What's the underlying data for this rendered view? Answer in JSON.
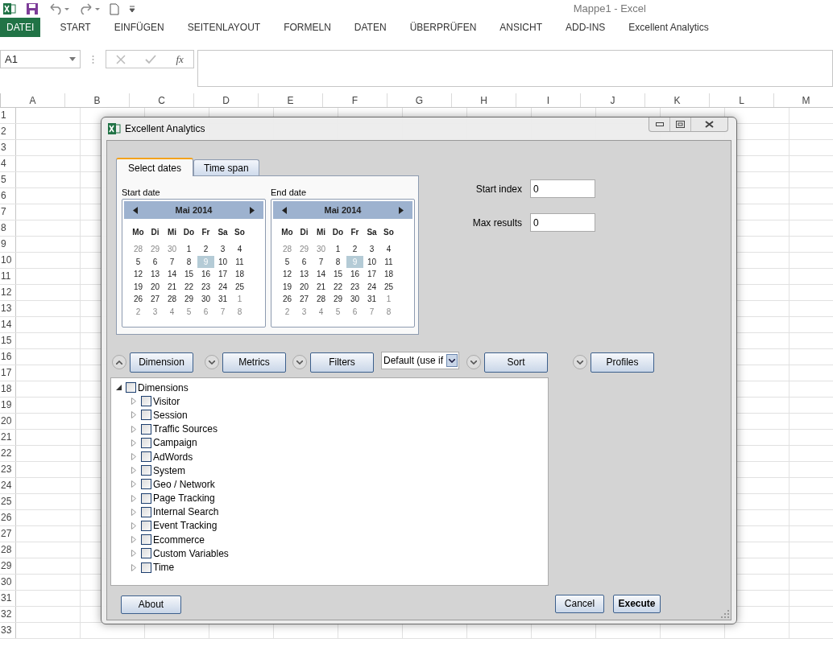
{
  "app": {
    "title": "Mappe1 - Excel"
  },
  "ribbon_tabs": [
    {
      "label": "DATEI",
      "selected": true
    },
    {
      "label": "START",
      "selected": false
    },
    {
      "label": "EINFÜGEN",
      "selected": false
    },
    {
      "label": "SEITENLAYOUT",
      "selected": false
    },
    {
      "label": "FORMELN",
      "selected": false
    },
    {
      "label": "DATEN",
      "selected": false
    },
    {
      "label": "ÜBERPRÜFEN",
      "selected": false
    },
    {
      "label": "ANSICHT",
      "selected": false
    },
    {
      "label": "ADD-INS",
      "selected": false
    },
    {
      "label": "Excellent Analytics",
      "selected": false
    }
  ],
  "name_box": {
    "value": "A1"
  },
  "formula_bar": {
    "fx": "fx"
  },
  "sheet": {
    "columns": [
      "A",
      "B",
      "C",
      "D",
      "E",
      "F",
      "G",
      "H",
      "I",
      "J",
      "K",
      "L",
      "M"
    ],
    "rows": [
      "1",
      "2",
      "3",
      "4",
      "5",
      "6",
      "7",
      "8",
      "9",
      "10",
      "11",
      "12",
      "13",
      "14",
      "15",
      "16",
      "17",
      "18",
      "19",
      "20",
      "21",
      "22",
      "23",
      "24",
      "25",
      "26",
      "27",
      "28",
      "29",
      "30",
      "31",
      "32",
      "33"
    ]
  },
  "dialog": {
    "title": "Excellent Analytics",
    "tabs": [
      {
        "label": "Select dates",
        "selected": true
      },
      {
        "label": "Time span",
        "selected": false
      }
    ],
    "calendars": [
      {
        "label": "Start date",
        "month": "Mai 2014",
        "weekdays": [
          "Mo",
          "Di",
          "Mi",
          "Do",
          "Fr",
          "Sa",
          "So"
        ],
        "weeks": [
          [
            {
              "day": "28",
              "muted": true,
              "selected": false
            },
            {
              "day": "29",
              "muted": true,
              "selected": false
            },
            {
              "day": "30",
              "muted": true,
              "selected": false
            },
            {
              "day": "1",
              "muted": false,
              "selected": false
            },
            {
              "day": "2",
              "muted": false,
              "selected": false
            },
            {
              "day": "3",
              "muted": false,
              "selected": false
            },
            {
              "day": "4",
              "muted": false,
              "selected": false
            }
          ],
          [
            {
              "day": "5",
              "muted": false,
              "selected": false
            },
            {
              "day": "6",
              "muted": false,
              "selected": false
            },
            {
              "day": "7",
              "muted": false,
              "selected": false
            },
            {
              "day": "8",
              "muted": false,
              "selected": false
            },
            {
              "day": "9",
              "muted": false,
              "selected": true
            },
            {
              "day": "10",
              "muted": false,
              "selected": false
            },
            {
              "day": "11",
              "muted": false,
              "selected": false
            }
          ],
          [
            {
              "day": "12",
              "muted": false,
              "selected": false
            },
            {
              "day": "13",
              "muted": false,
              "selected": false
            },
            {
              "day": "14",
              "muted": false,
              "selected": false
            },
            {
              "day": "15",
              "muted": false,
              "selected": false
            },
            {
              "day": "16",
              "muted": false,
              "selected": false
            },
            {
              "day": "17",
              "muted": false,
              "selected": false
            },
            {
              "day": "18",
              "muted": false,
              "selected": false
            }
          ],
          [
            {
              "day": "19",
              "muted": false,
              "selected": false
            },
            {
              "day": "20",
              "muted": false,
              "selected": false
            },
            {
              "day": "21",
              "muted": false,
              "selected": false
            },
            {
              "day": "22",
              "muted": false,
              "selected": false
            },
            {
              "day": "23",
              "muted": false,
              "selected": false
            },
            {
              "day": "24",
              "muted": false,
              "selected": false
            },
            {
              "day": "25",
              "muted": false,
              "selected": false
            }
          ],
          [
            {
              "day": "26",
              "muted": false,
              "selected": false
            },
            {
              "day": "27",
              "muted": false,
              "selected": false
            },
            {
              "day": "28",
              "muted": false,
              "selected": false
            },
            {
              "day": "29",
              "muted": false,
              "selected": false
            },
            {
              "day": "30",
              "muted": false,
              "selected": false
            },
            {
              "day": "31",
              "muted": false,
              "selected": false
            },
            {
              "day": "1",
              "muted": true,
              "selected": false
            }
          ],
          [
            {
              "day": "2",
              "muted": true,
              "selected": false
            },
            {
              "day": "3",
              "muted": true,
              "selected": false
            },
            {
              "day": "4",
              "muted": true,
              "selected": false
            },
            {
              "day": "5",
              "muted": true,
              "selected": false
            },
            {
              "day": "6",
              "muted": true,
              "selected": false
            },
            {
              "day": "7",
              "muted": true,
              "selected": false
            },
            {
              "day": "8",
              "muted": true,
              "selected": false
            }
          ]
        ]
      },
      {
        "label": "End date",
        "month": "Mai 2014",
        "weekdays": [
          "Mo",
          "Di",
          "Mi",
          "Do",
          "Fr",
          "Sa",
          "So"
        ],
        "weeks": [
          [
            {
              "day": "28",
              "muted": true,
              "selected": false
            },
            {
              "day": "29",
              "muted": true,
              "selected": false
            },
            {
              "day": "30",
              "muted": true,
              "selected": false
            },
            {
              "day": "1",
              "muted": false,
              "selected": false
            },
            {
              "day": "2",
              "muted": false,
              "selected": false
            },
            {
              "day": "3",
              "muted": false,
              "selected": false
            },
            {
              "day": "4",
              "muted": false,
              "selected": false
            }
          ],
          [
            {
              "day": "5",
              "muted": false,
              "selected": false
            },
            {
              "day": "6",
              "muted": false,
              "selected": false
            },
            {
              "day": "7",
              "muted": false,
              "selected": false
            },
            {
              "day": "8",
              "muted": false,
              "selected": false
            },
            {
              "day": "9",
              "muted": false,
              "selected": true
            },
            {
              "day": "10",
              "muted": false,
              "selected": false
            },
            {
              "day": "11",
              "muted": false,
              "selected": false
            }
          ],
          [
            {
              "day": "12",
              "muted": false,
              "selected": false
            },
            {
              "day": "13",
              "muted": false,
              "selected": false
            },
            {
              "day": "14",
              "muted": false,
              "selected": false
            },
            {
              "day": "15",
              "muted": false,
              "selected": false
            },
            {
              "day": "16",
              "muted": false,
              "selected": false
            },
            {
              "day": "17",
              "muted": false,
              "selected": false
            },
            {
              "day": "18",
              "muted": false,
              "selected": false
            }
          ],
          [
            {
              "day": "19",
              "muted": false,
              "selected": false
            },
            {
              "day": "20",
              "muted": false,
              "selected": false
            },
            {
              "day": "21",
              "muted": false,
              "selected": false
            },
            {
              "day": "22",
              "muted": false,
              "selected": false
            },
            {
              "day": "23",
              "muted": false,
              "selected": false
            },
            {
              "day": "24",
              "muted": false,
              "selected": false
            },
            {
              "day": "25",
              "muted": false,
              "selected": false
            }
          ],
          [
            {
              "day": "26",
              "muted": false,
              "selected": false
            },
            {
              "day": "27",
              "muted": false,
              "selected": false
            },
            {
              "day": "28",
              "muted": false,
              "selected": false
            },
            {
              "day": "29",
              "muted": false,
              "selected": false
            },
            {
              "day": "30",
              "muted": false,
              "selected": false
            },
            {
              "day": "31",
              "muted": false,
              "selected": false
            },
            {
              "day": "1",
              "muted": true,
              "selected": false
            }
          ],
          [
            {
              "day": "2",
              "muted": true,
              "selected": false
            },
            {
              "day": "3",
              "muted": true,
              "selected": false
            },
            {
              "day": "4",
              "muted": true,
              "selected": false
            },
            {
              "day": "5",
              "muted": true,
              "selected": false
            },
            {
              "day": "6",
              "muted": true,
              "selected": false
            },
            {
              "day": "7",
              "muted": true,
              "selected": false
            },
            {
              "day": "8",
              "muted": true,
              "selected": false
            }
          ]
        ]
      }
    ],
    "fields": [
      {
        "label": "Start index",
        "value": "0"
      },
      {
        "label": "Max results",
        "value": "0"
      }
    ],
    "toolbar": [
      {
        "kind": "section",
        "label": "Dimension",
        "expanded": true
      },
      {
        "kind": "section",
        "label": "Metrics",
        "expanded": false
      },
      {
        "kind": "section",
        "label": "Filters",
        "expanded": false
      },
      {
        "kind": "select",
        "value": "Default (use if"
      },
      {
        "kind": "section",
        "label": "Sort",
        "expanded": false
      },
      {
        "kind": "section",
        "label": "Profiles",
        "expanded": false
      }
    ],
    "tree": [
      {
        "label": "Dimensions",
        "checked": false,
        "expanded": true,
        "children": [
          {
            "label": "Visitor",
            "checked": false,
            "expanded": false
          },
          {
            "label": "Session",
            "checked": false,
            "expanded": false
          },
          {
            "label": "Traffic Sources",
            "checked": false,
            "expanded": false
          },
          {
            "label": "Campaign",
            "checked": false,
            "expanded": false
          },
          {
            "label": "AdWords",
            "checked": false,
            "expanded": false
          },
          {
            "label": "System",
            "checked": false,
            "expanded": false
          },
          {
            "label": "Geo / Network",
            "checked": false,
            "expanded": false
          },
          {
            "label": "Page Tracking",
            "checked": false,
            "expanded": false
          },
          {
            "label": "Internal Search",
            "checked": false,
            "expanded": false
          },
          {
            "label": "Event Tracking",
            "checked": false,
            "expanded": false
          },
          {
            "label": "Ecommerce",
            "checked": false,
            "expanded": false
          },
          {
            "label": "Custom Variables",
            "checked": false,
            "expanded": false
          },
          {
            "label": "Time",
            "checked": false,
            "expanded": false
          }
        ]
      }
    ],
    "buttons": [
      {
        "label": "About",
        "kind": "normal"
      },
      {
        "label": "Cancel",
        "kind": "normal"
      },
      {
        "label": "Execute",
        "kind": "default"
      }
    ]
  }
}
